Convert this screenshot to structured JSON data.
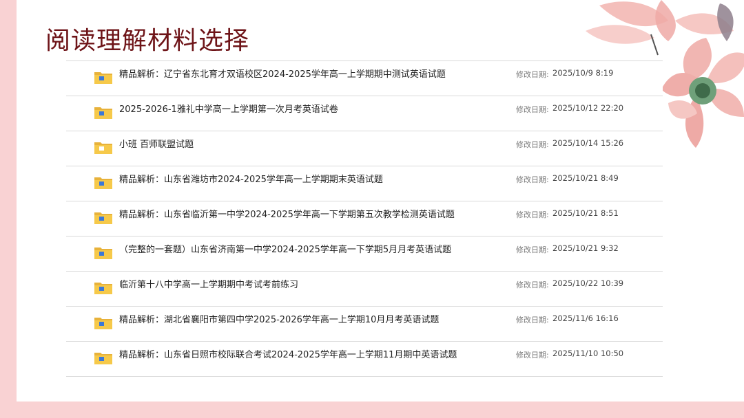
{
  "page": {
    "title": "阅读理解材料选择"
  },
  "files": [
    {
      "name": "精品解析：辽宁省东北育才双语校区2024-2025学年高一上学期期中测试英语试题",
      "date_label": "修改日期:",
      "date": "2025/10/9 8:19",
      "icon": "folder-with-doc-icon"
    },
    {
      "name": "2025-2026-1雅礼中学高一上学期第一次月考英语试卷",
      "date_label": "修改日期:",
      "date": "2025/10/12 22:20",
      "icon": "folder-with-doc-icon"
    },
    {
      "name": "小班 百师联盟试题",
      "date_label": "修改日期:",
      "date": "2025/10/14 15:26",
      "icon": "folder-icon"
    },
    {
      "name": "精品解析：山东省潍坊市2024-2025学年高一上学期期末英语试题",
      "date_label": "修改日期:",
      "date": "2025/10/21 8:49",
      "icon": "folder-with-doc-icon"
    },
    {
      "name": "精品解析：山东省临沂第一中学2024-2025学年高一下学期第五次教学检测英语试题",
      "date_label": "修改日期:",
      "date": "2025/10/21 8:51",
      "icon": "folder-with-doc-icon"
    },
    {
      "name": "（完整的一套题）山东省济南第一中学2024-2025学年高一下学期5月月考英语试题",
      "date_label": "修改日期:",
      "date": "2025/10/21 9:32",
      "icon": "folder-with-doc-icon"
    },
    {
      "name": "临沂第十八中学高一上学期期中考试考前练习",
      "date_label": "修改日期:",
      "date": "2025/10/22 10:39",
      "icon": "folder-with-doc-icon"
    },
    {
      "name": "精品解析：湖北省襄阳市第四中学2025-2026学年高一上学期10月月考英语试题",
      "date_label": "修改日期:",
      "date": "2025/11/6 16:16",
      "icon": "folder-with-doc-icon"
    },
    {
      "name": "精品解析：山东省日照市校际联合考试2024-2025学年高一上学期11月期中英语试题",
      "date_label": "修改日期:",
      "date": "2025/11/10 10:50",
      "icon": "folder-with-doc-icon"
    }
  ],
  "colors": {
    "title": "#6e1418",
    "background_pink": "#f9d2d3",
    "folder": "#f6c94a",
    "folder_tab": "#e8b23a"
  }
}
